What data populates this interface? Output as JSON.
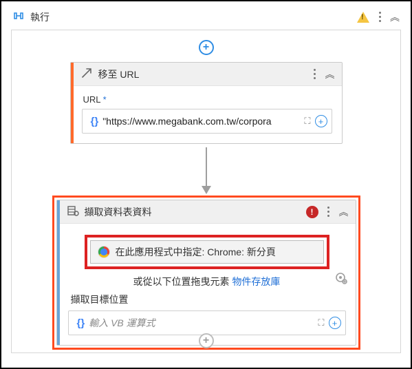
{
  "header": {
    "title": "執行"
  },
  "node1": {
    "title": "移至 URL",
    "field_label": "URL",
    "required_mark": "*",
    "value": "\"https://www.megabank.com.tw/corpora"
  },
  "node2": {
    "title": "擷取資料表資料",
    "indicate_text": "在此應用程式中指定: Chrome: 新分頁",
    "subline_text": "或從以下位置拖曳元素",
    "subline_link": "物件存放庫",
    "target_label": "擷取目標位置",
    "target_placeholder": "輸入 VB 運算式"
  }
}
